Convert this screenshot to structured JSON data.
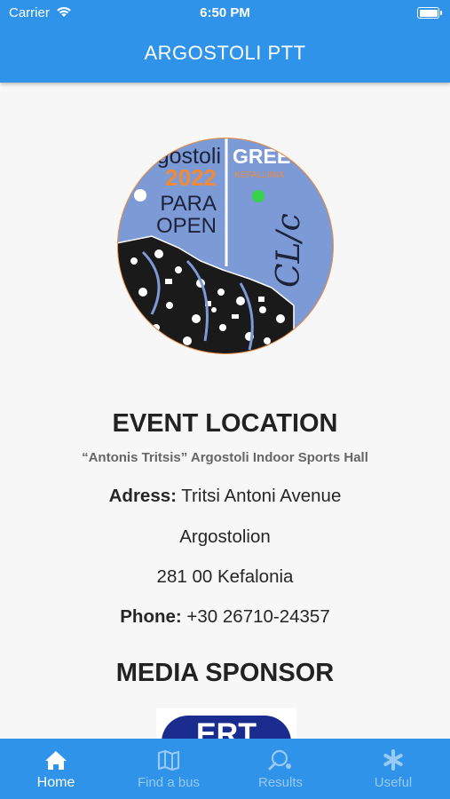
{
  "status_bar": {
    "carrier": "Carrier",
    "time": "6:50 PM"
  },
  "header": {
    "title": "ARGOSTOLI PTT"
  },
  "logo": {
    "text_left_top": "gostoli",
    "year": "2022",
    "line1": "PARA",
    "line2": "OPEN",
    "text_right_top": "GREE",
    "text_right_sub": "KEFALLINIA",
    "script": "CL/c"
  },
  "event_location": {
    "title": "EVENT LOCATION",
    "venue": "“Antonis Tritsis” Argostoli Indoor Sports Hall",
    "address_label": "Adress:",
    "address_value": "Tritsi Antoni Avenue",
    "city": "Argostolion",
    "postal": "281 00 Kefalonia",
    "phone_label": "Phone:",
    "phone_value": "+30 26710-24357"
  },
  "media_sponsor": {
    "title": "MEDIA SPONSOR",
    "logo_text": "ERT"
  },
  "tabs": [
    {
      "label": "Home",
      "icon": "home-icon",
      "active": true
    },
    {
      "label": "Find a bus",
      "icon": "map-icon",
      "active": false
    },
    {
      "label": "Results",
      "icon": "table-tennis-icon",
      "active": false
    },
    {
      "label": "Useful",
      "icon": "asterisk-icon",
      "active": false
    }
  ],
  "colors": {
    "primary": "#2f93ea",
    "logo_blue": "#7b9ad6",
    "logo_orange": "#f08a3a",
    "inactive_tab": "#98caf3"
  }
}
